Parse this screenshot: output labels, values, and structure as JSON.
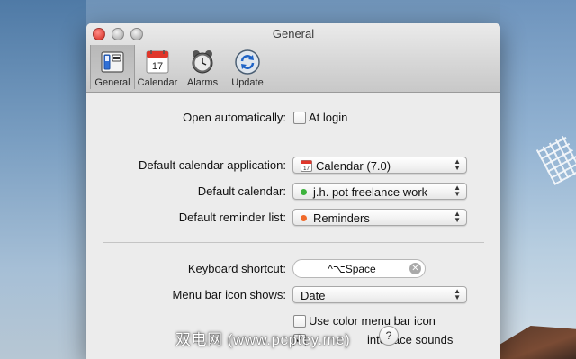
{
  "window": {
    "title": "General"
  },
  "toolbar": {
    "items": [
      {
        "label": "General",
        "icon": "general-switch-icon",
        "selected": true
      },
      {
        "label": "Calendar",
        "icon": "calendar-icon",
        "day": "17"
      },
      {
        "label": "Alarms",
        "icon": "alarm-clock-icon"
      },
      {
        "label": "Update",
        "icon": "update-icon"
      }
    ]
  },
  "general": {
    "open_automatically_label": "Open automatically:",
    "at_login_label": "At login",
    "at_login_checked": false,
    "default_calendar_app_label": "Default calendar application:",
    "default_calendar_app_value": "Calendar (7.0)",
    "default_calendar_label": "Default calendar:",
    "default_calendar_value": "j.h. pot freelance work",
    "default_calendar_color": "#3db33d",
    "default_reminder_label": "Default reminder list:",
    "default_reminder_value": "Reminders",
    "default_reminder_color": "#f06a2a",
    "keyboard_shortcut_label": "Keyboard shortcut:",
    "keyboard_shortcut_value": "^⌥Space",
    "menu_bar_icon_label": "Menu bar icon shows:",
    "menu_bar_icon_value": "Date",
    "use_color_icon_label": "Use color menu bar icon",
    "use_color_icon_checked": false,
    "interface_sounds_label": "interface sounds",
    "interface_sounds_checked": true,
    "help_label": "?"
  },
  "watermark": "双电网 (www.pcptey.me)"
}
